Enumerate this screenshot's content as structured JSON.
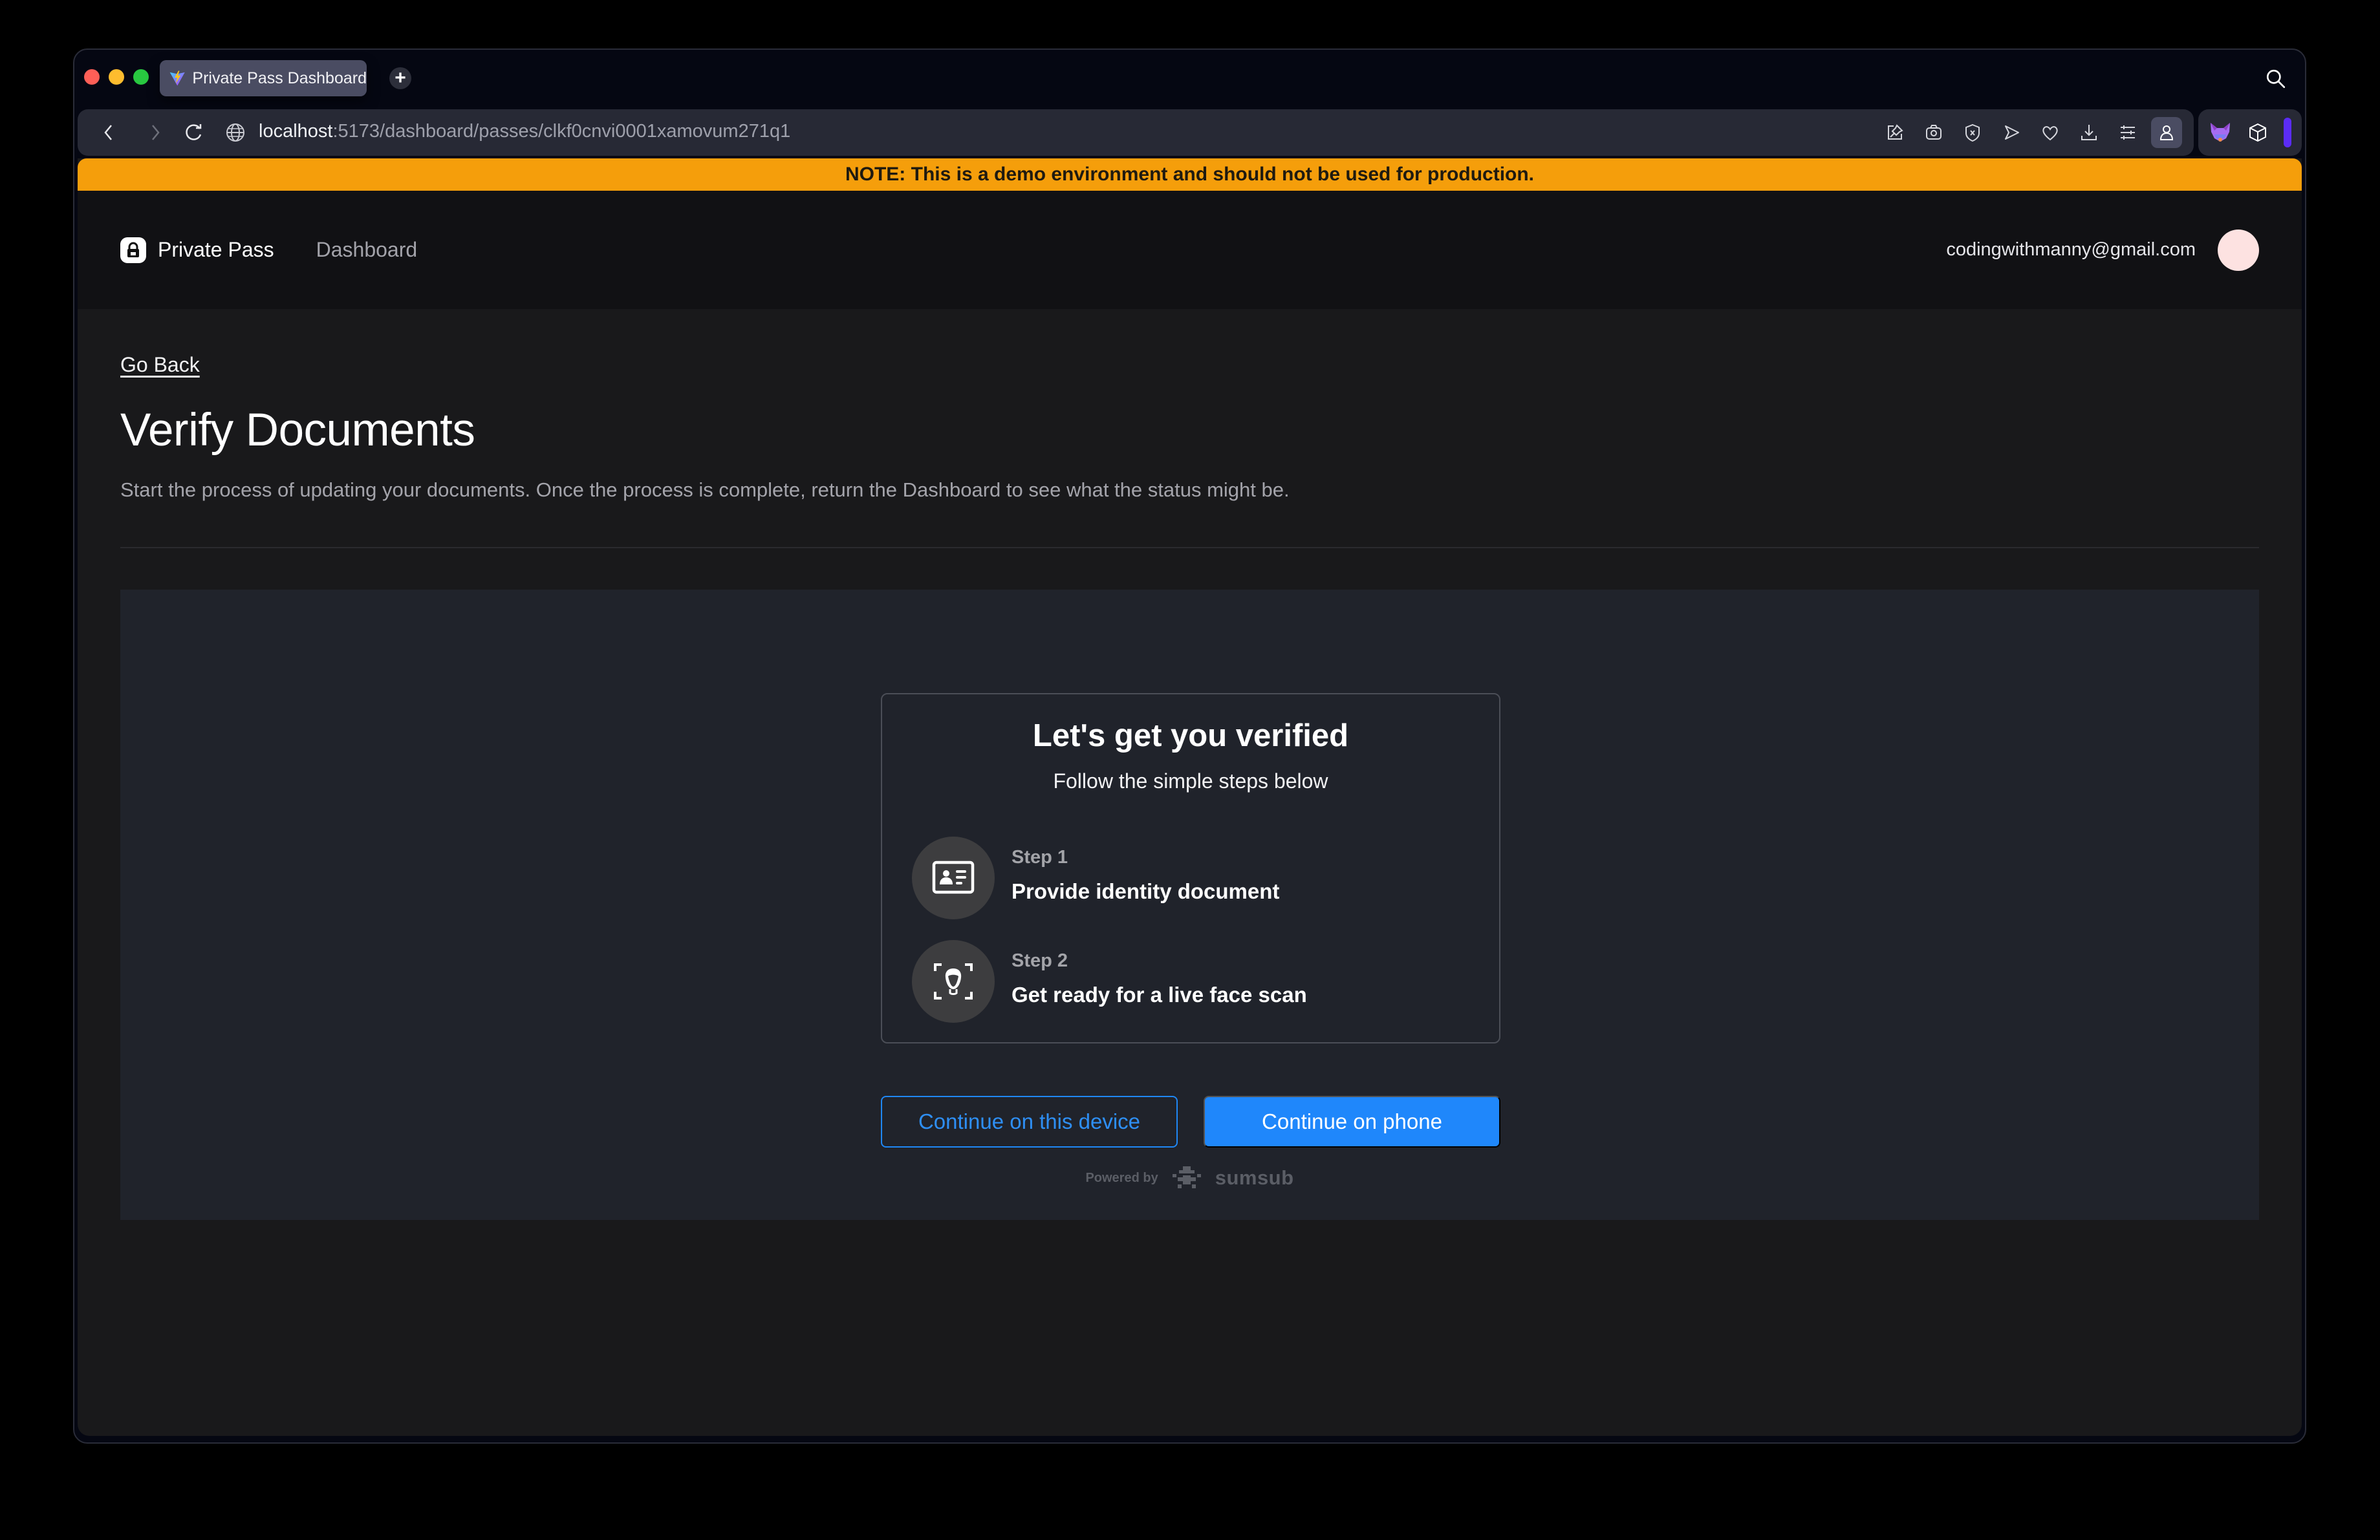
{
  "browser": {
    "tab_title": "Private Pass Dashboard",
    "new_tab_label": "+",
    "url_host": "localhost",
    "url_path": ":5173/dashboard/passes/clkf0cnvi0001xamovum271q1",
    "toolbar_icons": [
      "pin-icon",
      "camera-icon",
      "shield-x-icon",
      "send-icon",
      "heart-icon",
      "download-icon",
      "sliders-icon",
      "profile-icon"
    ],
    "extensions": [
      "metamask-fox-icon",
      "cube-icon"
    ]
  },
  "banner": {
    "text": "NOTE: This is a demo environment and should not be used for production."
  },
  "header": {
    "brand_name": "Private Pass",
    "nav_dashboard": "Dashboard",
    "user_email": "codingwithmanny@gmail.com"
  },
  "main": {
    "go_back": "Go Back",
    "title": "Verify Documents",
    "description": "Start the process of updating your documents. Once the process is complete, return the Dashboard to see what the status might be."
  },
  "verification": {
    "title": "Let's get you verified",
    "subtitle": "Follow the simple steps below",
    "steps": [
      {
        "number": "Step 1",
        "label": "Provide identity document",
        "icon": "id-card-icon"
      },
      {
        "number": "Step 2",
        "label": "Get ready for a live face scan",
        "icon": "face-scan-icon"
      }
    ],
    "continue_device": "Continue on this device",
    "continue_phone": "Continue on phone",
    "powered_by": "Powered by",
    "provider": "sumsub"
  },
  "colors": {
    "banner": "#f59e0b",
    "primary_button": "#1f87fb",
    "panel_bg": "#20232b",
    "page_bg": "#19191b"
  }
}
